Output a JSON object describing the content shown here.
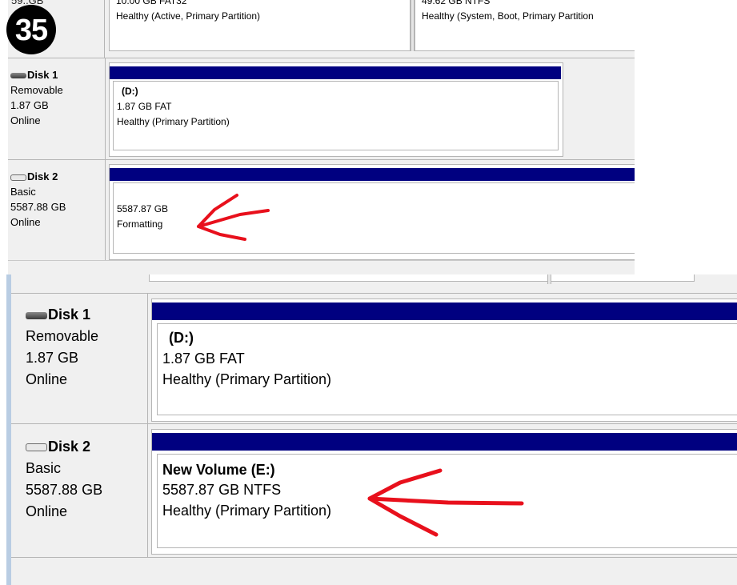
{
  "badge": "35",
  "top": {
    "partition_row": {
      "disk_capacity_clip": "59..GB",
      "volume_left": {
        "size": "10.00 GB FAT32",
        "status": "Healthy (Active, Primary Partition)"
      },
      "volume_right": {
        "size": "49.62 GB NTFS",
        "status": "Healthy (System, Boot, Primary Partition"
      }
    },
    "disk1": {
      "name": "Disk 1",
      "type": "Removable",
      "size": "1.87 GB",
      "state": "Online",
      "volume": {
        "label": "(D:)",
        "size": "1.87 GB FAT",
        "status": "Healthy (Primary Partition)"
      }
    },
    "disk2": {
      "name": "Disk 2",
      "type": "Basic",
      "size": "5587.88 GB",
      "state": "Online",
      "volume": {
        "size": "5587.87 GB",
        "status": "Formatting"
      }
    }
  },
  "bottom": {
    "disk1": {
      "name": "Disk 1",
      "type": "Removable",
      "size": "1.87 GB",
      "state": "Online",
      "volume": {
        "label": "(D:)",
        "size": "1.87 GB FAT",
        "status": "Healthy (Primary Partition)"
      }
    },
    "disk2": {
      "name": "Disk 2",
      "type": "Basic",
      "size": "5587.88 GB",
      "state": "Online",
      "volume": {
        "label": "New Volume  (E:)",
        "size": "5587.87 GB NTFS",
        "status": "Healthy (Primary Partition)"
      }
    }
  },
  "colors": {
    "partition_bar": "#000080",
    "annotation_arrow": "#e8101c",
    "panel_background": "#f0f0f0"
  },
  "icons": [
    "removable-disk-icon",
    "basic-disk-icon",
    "red-arrow-annotation"
  ]
}
